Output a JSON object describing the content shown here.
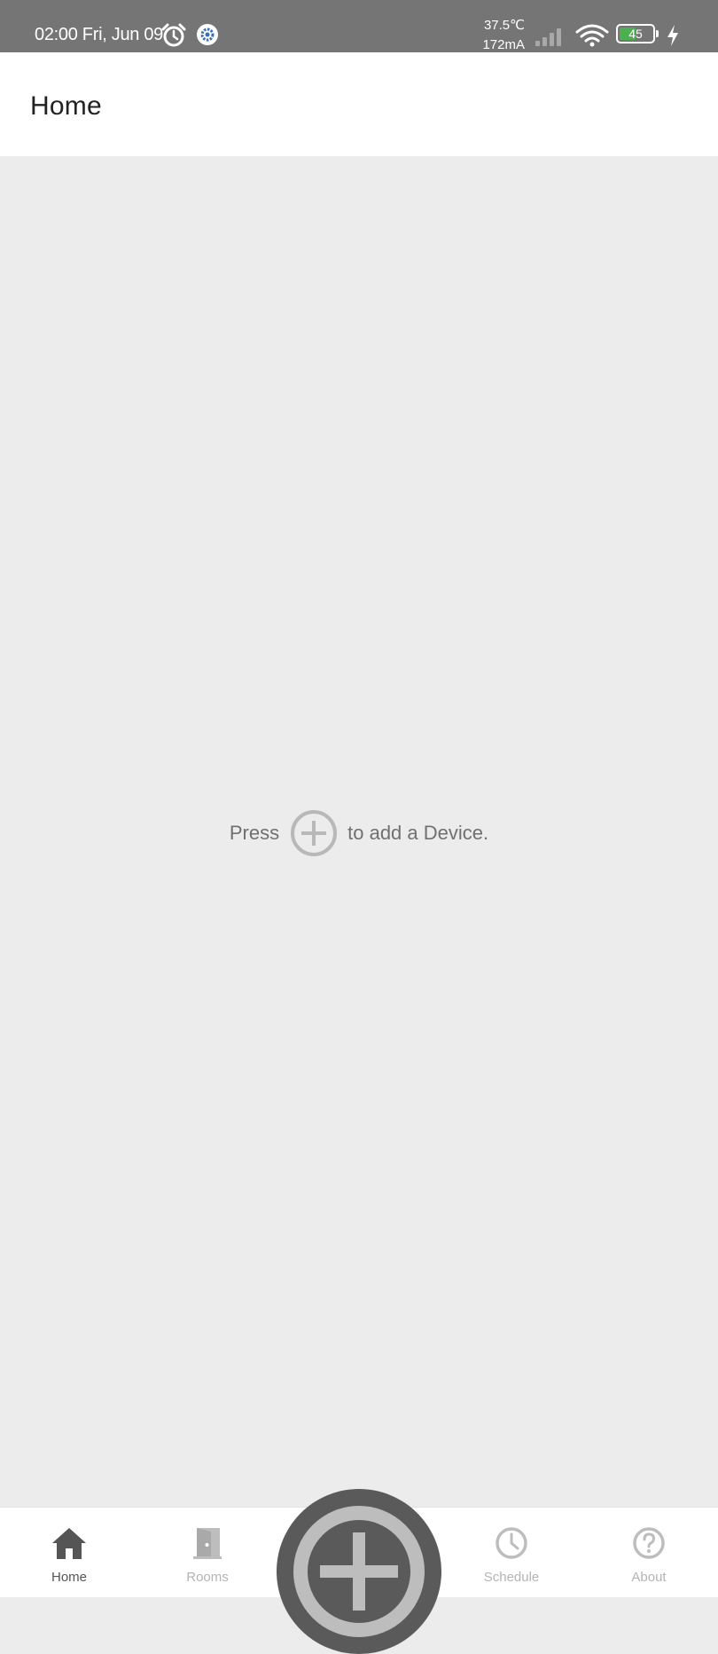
{
  "status_bar": {
    "time": "02:00 Fri, Jun 09",
    "temperature": "37.5℃",
    "current": "172mA",
    "battery_level": "45",
    "battery_fill": 0.45,
    "icons": [
      "alarm-clock-icon",
      "gear-icon",
      "cell-signal-icon",
      "wifi-icon",
      "battery-icon",
      "charging-bolt-icon"
    ]
  },
  "header": {
    "title": "Home"
  },
  "empty_state": {
    "prefix": "Press",
    "suffix": "to add a Device.",
    "icon": "add-circle-icon"
  },
  "bottom_nav": {
    "items": [
      {
        "label": "Home",
        "icon": "home-icon",
        "active": true
      },
      {
        "label": "Rooms",
        "icon": "door-icon",
        "active": false
      },
      {
        "label": "Schedule",
        "icon": "clock-icon",
        "active": false
      },
      {
        "label": "About",
        "icon": "help-circle-icon",
        "active": false
      }
    ],
    "fab_icon": "add-circle-icon"
  },
  "colors": {
    "status_bar_bg": "#757575",
    "page_bg": "#ececec",
    "battery_fill": "#4caf50",
    "fab_bg": "#5a5a5a",
    "active_nav": "#555555",
    "inactive_nav": "#b4b4b4"
  }
}
